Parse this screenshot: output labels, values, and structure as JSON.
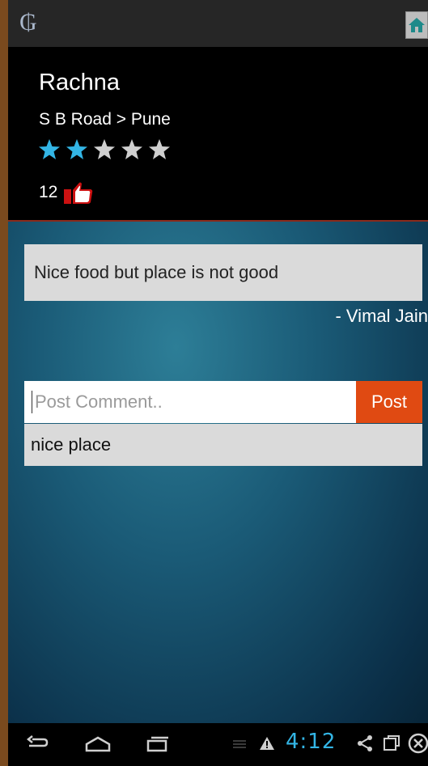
{
  "app": {
    "logo_icon": "cp-monogram-icon",
    "home_icon": "home-icon"
  },
  "place": {
    "name": "Rachna",
    "location": "S B Road > Pune",
    "rating": 2,
    "rating_max": 5,
    "likes": "12",
    "like_icon": "thumbs-up-icon"
  },
  "review": {
    "text": "Nice food but place is not good",
    "author": "- Vimal Jain"
  },
  "comment": {
    "placeholder": "Post Comment..",
    "post_label": "Post",
    "items": [
      "nice place"
    ]
  },
  "status_bar": {
    "time": "4:12"
  },
  "colors": {
    "star_active": "#33b5e5",
    "star_inactive": "#cfcfcf",
    "post_button": "#e04a12",
    "header_bg": "#000000",
    "clock": "#33b5e5"
  }
}
